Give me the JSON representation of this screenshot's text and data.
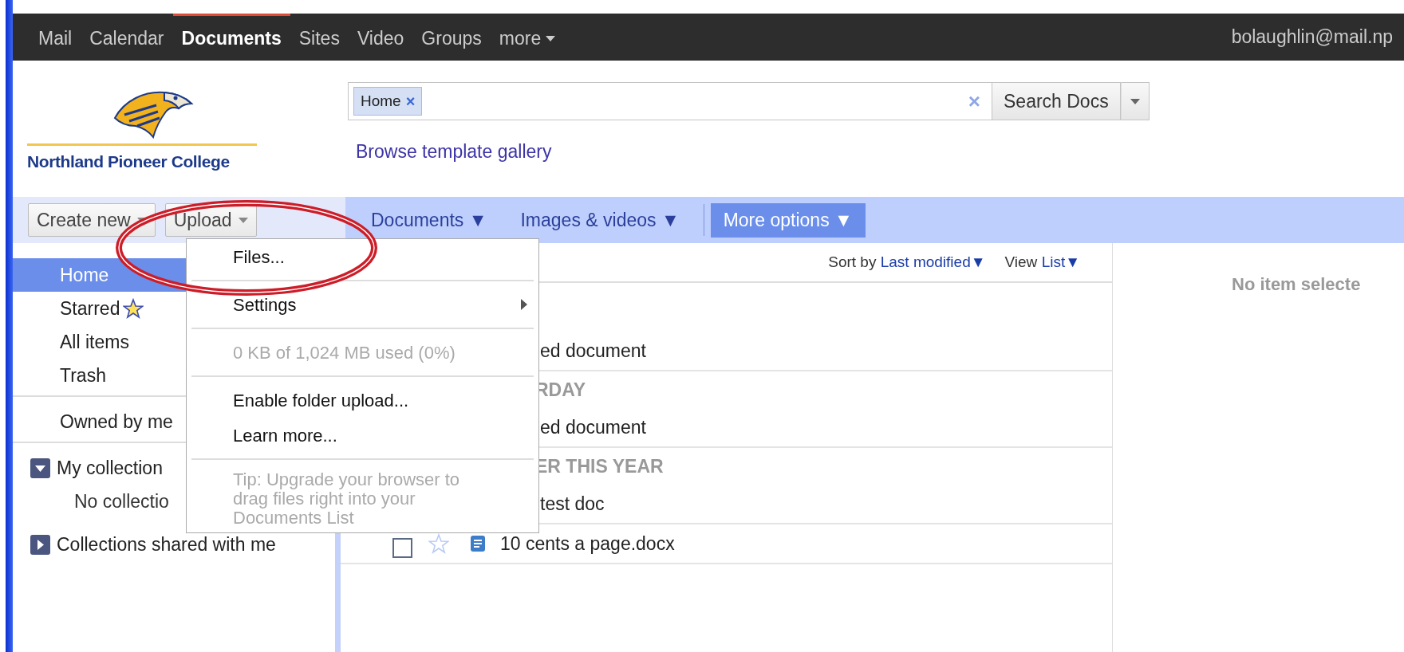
{
  "top_bar": {
    "apps": [
      {
        "label": "Mail",
        "selected": false
      },
      {
        "label": "Calendar",
        "selected": false
      },
      {
        "label": "Documents",
        "selected": true
      },
      {
        "label": "Sites",
        "selected": false
      },
      {
        "label": "Video",
        "selected": false
      },
      {
        "label": "Groups",
        "selected": false
      },
      {
        "label": "more",
        "selected": false,
        "kind": "menu"
      }
    ],
    "account": "bolaughlin@mail.np"
  },
  "logo": {
    "text": "Northland Pioneer College"
  },
  "search": {
    "chips": [
      {
        "label": "Home",
        "remove": "×"
      }
    ],
    "clear": "×",
    "button": "Search Docs"
  },
  "template_link": "Browse template gallery",
  "toolbar": {
    "buttons": [
      {
        "label": "Create new"
      },
      {
        "label": "Upload"
      }
    ],
    "filters": [
      {
        "label": "Documents ▼",
        "selected": false
      },
      {
        "label": "Images & videos ▼",
        "selected": false
      },
      {
        "label": "More options ▼",
        "selected": true
      }
    ]
  },
  "sidebar": {
    "groups": [
      {
        "items": [
          {
            "kind": "link",
            "label": "Home",
            "selected": true
          },
          {
            "kind": "starred",
            "label": "Starred",
            "selected": false
          },
          {
            "kind": "link",
            "label": "All items",
            "selected": false
          },
          {
            "kind": "link",
            "label": "Trash",
            "selected": false
          }
        ]
      },
      {
        "items": [
          {
            "kind": "link",
            "label": "Owned by me",
            "selected": false
          }
        ]
      },
      {
        "items": [
          {
            "kind": "collection",
            "label": "My collection",
            "selected": false,
            "expanded": true,
            "children": [
              {
                "kind": "note",
                "label": "No collectio"
              }
            ]
          },
          {
            "kind": "collection",
            "label": "Collections shared with me",
            "selected": false,
            "expanded": false
          }
        ]
      }
    ]
  },
  "upload_menu": {
    "items": [
      {
        "kind": "action",
        "label": "Files..."
      },
      {
        "kind": "divider"
      },
      {
        "kind": "submenu",
        "label": "Settings"
      },
      {
        "kind": "divider"
      },
      {
        "kind": "info",
        "label": "0 KB of 1,024 MB used (0%)"
      },
      {
        "kind": "divider"
      },
      {
        "kind": "action",
        "label": "Enable folder upload..."
      },
      {
        "kind": "action",
        "label": "Learn more..."
      },
      {
        "kind": "divider"
      },
      {
        "kind": "tip",
        "label": "Tip: Upgrade your browser to drag files right into your Documents List"
      }
    ]
  },
  "list": {
    "sort": {
      "label": "Sort by",
      "value": "Last modified▼"
    },
    "view": {
      "label": "View",
      "value": "List▼"
    },
    "entries": [
      {
        "kind": "row",
        "name": "ed document"
      },
      {
        "kind": "group",
        "label": "RDAY"
      },
      {
        "kind": "row",
        "name": "ed document"
      },
      {
        "kind": "group",
        "label": "ER THIS YEAR"
      },
      {
        "kind": "row",
        "name": "test doc"
      },
      {
        "kind": "row",
        "name": "10 cents a page.docx",
        "checked": false,
        "starred": false
      }
    ]
  },
  "details": {
    "empty": "No item selecte"
  }
}
